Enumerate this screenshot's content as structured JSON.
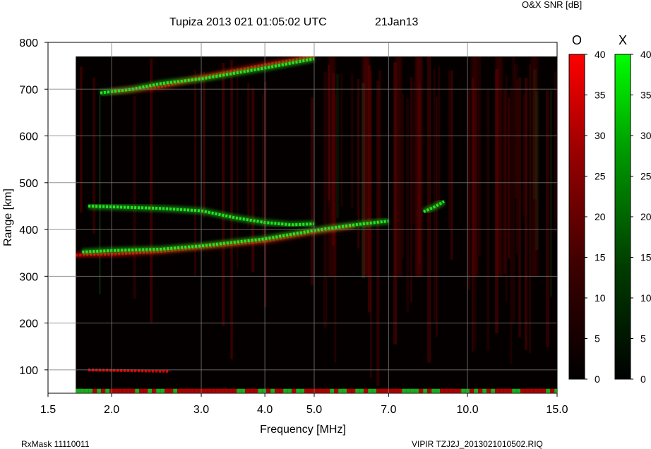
{
  "chart_data": {
    "type": "heatmap",
    "title": "Tupiza 2013 021 01:05:02 UTC",
    "date_label": "21Jan13",
    "colorbar_title": "O&X SNR [dB]",
    "xlabel": "Frequency [MHz]",
    "ylabel": "Range [km]",
    "x_scale": "log",
    "xlim": [
      1.5,
      15.0
    ],
    "ylim": [
      50,
      800
    ],
    "x_ticks": [
      1.5,
      2.0,
      3.0,
      4.0,
      5.0,
      7.0,
      10.0,
      15.0
    ],
    "x_tick_labels": [
      "1.5",
      "2.0",
      "3.0",
      "4.0",
      "5.0",
      "7.0",
      "10.0",
      "15.0"
    ],
    "y_ticks": [
      100,
      200,
      300,
      400,
      500,
      600,
      700,
      800
    ],
    "y_tick_labels": [
      "100",
      "200",
      "300",
      "400",
      "500",
      "600",
      "700",
      "800"
    ],
    "grid": true,
    "data_extent": {
      "freq_min": 1.7,
      "freq_max": 15.0,
      "range_min": 50,
      "range_max": 770
    },
    "colorbars": [
      {
        "name": "O",
        "color": "#ff0000",
        "min": 0,
        "max": 40,
        "ticks": [
          "0",
          "5",
          "10",
          "15",
          "20",
          "25",
          "30",
          "35",
          "40"
        ]
      },
      {
        "name": "X",
        "color": "#00ff00",
        "min": 0,
        "max": 40,
        "ticks": [
          "0",
          "5",
          "10",
          "15",
          "20",
          "25",
          "30",
          "35",
          "40"
        ]
      }
    ],
    "traces": [
      {
        "name": "O",
        "points": [
          [
            1.7,
            345
          ],
          [
            2.0,
            347
          ],
          [
            2.5,
            353
          ],
          [
            3.0,
            362
          ],
          [
            4.0,
            375
          ],
          [
            5.0,
            395
          ],
          [
            6.0,
            408
          ]
        ]
      },
      {
        "name": "X",
        "points": [
          [
            1.75,
            352
          ],
          [
            2.0,
            355
          ],
          [
            2.5,
            358
          ],
          [
            3.0,
            365
          ],
          [
            4.0,
            380
          ],
          [
            5.0,
            398
          ],
          [
            6.0,
            410
          ],
          [
            7.0,
            418
          ]
        ]
      },
      {
        "name": "X",
        "points": [
          [
            8.2,
            438
          ],
          [
            8.6,
            448
          ],
          [
            9.0,
            460
          ]
        ]
      },
      {
        "name": "O",
        "points": [
          [
            2.0,
            695
          ],
          [
            2.5,
            705
          ],
          [
            3.0,
            725
          ],
          [
            4.0,
            752
          ],
          [
            5.0,
            770
          ]
        ]
      },
      {
        "name": "X",
        "points": [
          [
            1.9,
            692
          ],
          [
            2.2,
            700
          ],
          [
            2.5,
            712
          ],
          [
            3.0,
            722
          ],
          [
            4.0,
            745
          ],
          [
            5.0,
            765
          ]
        ]
      },
      {
        "name": "X",
        "points": [
          [
            1.8,
            450
          ],
          [
            2.5,
            445
          ],
          [
            3.0,
            440
          ],
          [
            3.5,
            425
          ],
          [
            4.0,
            415
          ],
          [
            4.5,
            410
          ],
          [
            5.0,
            412
          ]
        ]
      },
      {
        "name": "O",
        "points": [
          [
            1.8,
            100
          ],
          [
            2.2,
            98
          ],
          [
            2.6,
            97
          ]
        ]
      }
    ]
  },
  "footer": {
    "left": "RxMask 11110011",
    "right": "VIPIR  TZJ2J_2013021010502.RIQ"
  }
}
